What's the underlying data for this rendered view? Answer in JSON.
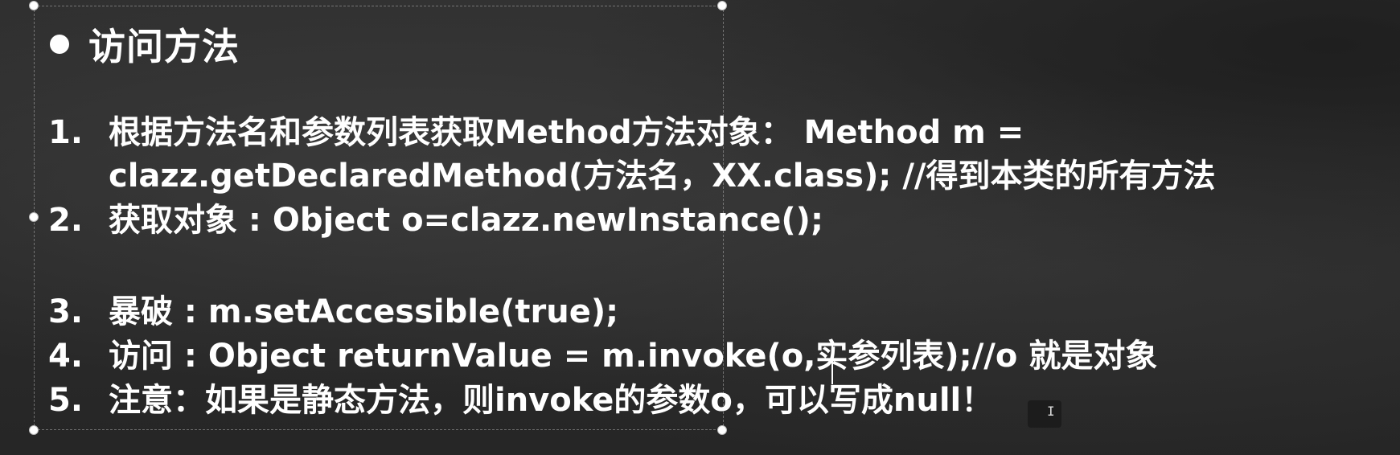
{
  "slide": {
    "heading": "访问方法",
    "items": [
      {
        "num": "1.",
        "text": "根据方法名和参数列表获取Method方法对象：  Method m ="
      },
      {
        "num": "",
        "text": "clazz.getDeclaredMethod(方法名，XX.class); //得到本类的所有方法"
      },
      {
        "num": "2.",
        "text": "获取对象 : Object o=clazz.newInstance();"
      },
      {
        "num": "3.",
        "text": "暴破 : m.setAccessible(true);"
      },
      {
        "num": "4.",
        "text": "访问 : Object returnValue = m.invoke(o,实参列表);//o 就是对象"
      },
      {
        "num": "5.",
        "text": "注意：如果是静态方法，则invoke的参数o，可以写成null！"
      }
    ]
  },
  "colors": {
    "background": "#2c2c2c",
    "text": "#ffffff",
    "handle": "#ffffff"
  }
}
